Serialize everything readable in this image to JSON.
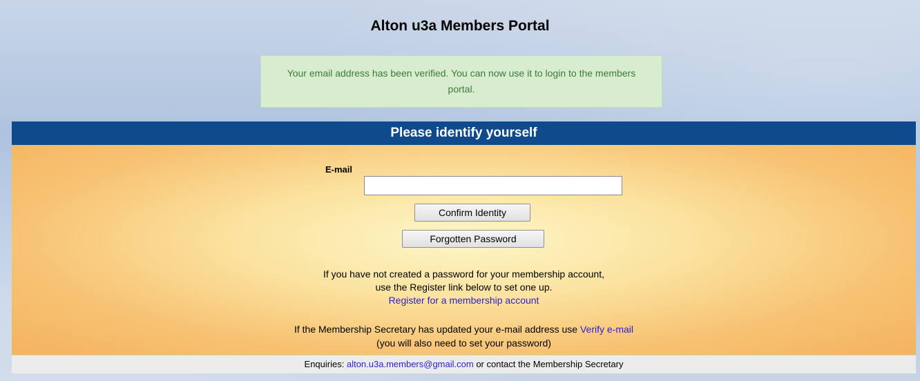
{
  "header": {
    "title": "Alton u3a Members Portal"
  },
  "notice": {
    "text": "Your email address has been verified. You can now use it to login to the members portal."
  },
  "panel": {
    "title": "Please identify yourself",
    "email_label": "E-mail",
    "email_value": "",
    "email_placeholder": "",
    "confirm_button": "Confirm Identity",
    "forgot_button": "Forgotten Password",
    "register_text_1": "If you have not created a password for your membership account,",
    "register_text_2": "use the Register link below to set one up.",
    "register_link": "Register for a membership account",
    "verify_text": "If the Membership Secretary has updated your e-mail address use",
    "verify_link": "Verify e-mail",
    "verify_note": "(you will also need to set your password)"
  },
  "footer": {
    "prefix": "Enquiries:",
    "email_link": "alton.u3a.members@gmail.com",
    "suffix": "or contact the Membership Secretary"
  },
  "colors": {
    "header_bar": "#0f4b8c",
    "notice_bg": "#d8edcf",
    "notice_text": "#3c7a3a",
    "link": "#2a1fd1"
  }
}
